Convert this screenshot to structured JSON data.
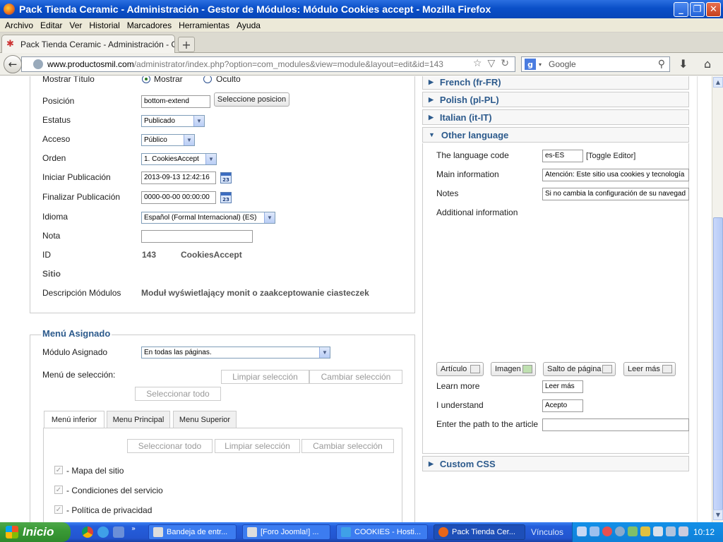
{
  "window": {
    "title": "Pack Tienda Ceramic - Administración - Gestor de Módulos: Módulo Cookies accept - Mozilla Firefox"
  },
  "menubar": [
    "Archivo",
    "Editar",
    "Ver",
    "Historial",
    "Marcadores",
    "Herramientas",
    "Ayuda"
  ],
  "tab": {
    "title": "Pack Tienda Ceramic - Administración - Gest..."
  },
  "nav": {
    "url_domain": "www.productosmil.com",
    "url_path": "/administrator/index.php?option=com_modules&view=module&layout=edit&id=143",
    "search_placeholder": "Google"
  },
  "form": {
    "show_title": {
      "label": "Mostrar Título",
      "opt_show": "Mostrar",
      "opt_hide": "Oculto"
    },
    "position": {
      "label": "Posición",
      "value": "bottom-extend",
      "button": "Seleccione posicion"
    },
    "status": {
      "label": "Estatus",
      "value": "Publicado"
    },
    "access": {
      "label": "Acceso",
      "value": "Público"
    },
    "order": {
      "label": "Orden",
      "value": "1. CookiesAccept"
    },
    "start_pub": {
      "label": "Iniciar Publicación",
      "value": "2013-09-13 12:42:16"
    },
    "end_pub": {
      "label": "Finalizar Publicación",
      "value": "0000-00-00 00:00:00"
    },
    "language": {
      "label": "Idioma",
      "value": "Español (Formal Internacional) (ES)"
    },
    "note": {
      "label": "Nota",
      "value": ""
    },
    "id": {
      "label": "ID",
      "value": "143",
      "name": "CookiesAccept"
    },
    "site": {
      "label": "Sitio"
    },
    "description": {
      "label": "Descripción Módulos",
      "value": "Moduł wyświetlający monit o zaakceptowanie ciasteczek"
    },
    "calendar_icon_text": "23"
  },
  "menu_assignment": {
    "legend": "Menú Asignado",
    "module_label": "Módulo Asignado",
    "module_value": "En todas las páginas.",
    "selection_label": "Menú de selección:",
    "btn_clear": "Limpiar selección",
    "btn_toggle": "Cambiar selección",
    "btn_select_all": "Seleccionar todo",
    "tabs": [
      "Menú inferior",
      "Menu Principal",
      "Menu Superior"
    ],
    "inner_btn_select_all": "Seleccionar todo",
    "inner_btn_clear": "Limpiar selección",
    "inner_btn_toggle": "Cambiar selección",
    "items": [
      "- Mapa del sitio",
      "- Condiciones del servicio",
      "- Política de privacidad"
    ]
  },
  "languages": {
    "french": "French (fr-FR)",
    "polish": "Polish (pl-PL)",
    "italian": "Italian (it-IT)",
    "other": "Other language",
    "custom_css": "Custom CSS"
  },
  "other_lang": {
    "code_label": "The language code",
    "code_value": "es-ES",
    "toggle_editor": "[Toggle Editor]",
    "main_label": "Main information",
    "main_value": "Atención: Este sitio usa cookies y tecnología",
    "notes_label": "Notes",
    "notes_value": "Si no cambia la configuración de su navegad",
    "additional_label": "Additional information",
    "btn_article": "Artículo",
    "btn_image": "Imagen",
    "btn_pagebreak": "Salto de página",
    "btn_readmore": "Leer más",
    "learn_label": "Learn more",
    "learn_value": "Leer más",
    "understand_label": "I understand",
    "understand_value": "Acepto",
    "path_label": "Enter the path to the article",
    "path_value": ""
  },
  "taskbar": {
    "start": "Inicio",
    "tasks": [
      "Bandeja de entr...",
      "[Foro Joomla!] ...",
      "COOKIES - Hosti...",
      "Pack Tienda Cer..."
    ],
    "links": "Vínculos",
    "clock": "10:12"
  },
  "colors": {
    "accent": "#2c5a8c",
    "titlebar": "#0a4fc8",
    "taskbar": "#245edb",
    "start": "#3a9a36"
  }
}
